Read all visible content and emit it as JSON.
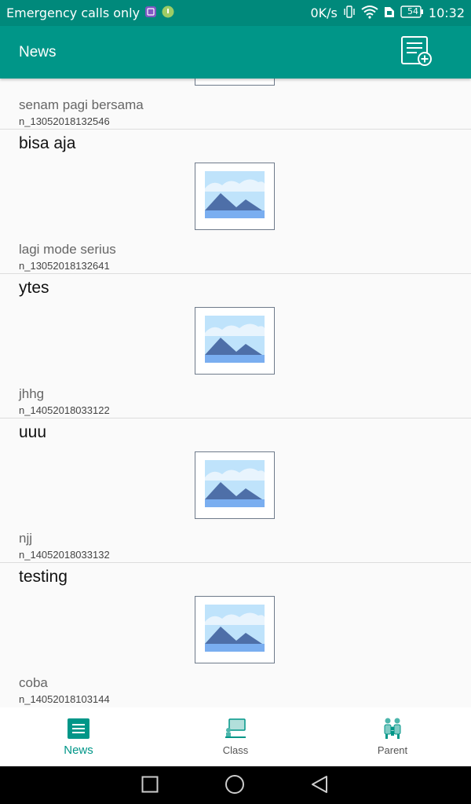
{
  "status_bar": {
    "carrier_text": "Emergency calls only",
    "net_speed": "0K/s",
    "battery": "54",
    "time": "10:32"
  },
  "app_bar": {
    "title": "News",
    "add_icon": "add-news-icon"
  },
  "news_partial": {
    "description": "senam pagi bersama",
    "id": "n_13052018132546"
  },
  "news": [
    {
      "title": "bisa aja",
      "description": "lagi mode serius",
      "id": "n_13052018132641"
    },
    {
      "title": "ytes",
      "description": "jhhg",
      "id": "n_14052018033122"
    },
    {
      "title": "uuu",
      "description": "njj",
      "id": "n_14052018033132"
    },
    {
      "title": "testing",
      "description": "coba",
      "id": "n_14052018103144"
    }
  ],
  "bottom_nav": {
    "items": [
      {
        "label": "News",
        "icon": "news-icon",
        "active": true
      },
      {
        "label": "Class",
        "icon": "class-icon",
        "active": false
      },
      {
        "label": "Parent",
        "icon": "parent-icon",
        "active": false
      }
    ]
  },
  "colors": {
    "primary": "#009688",
    "status_bar": "#00897b",
    "accent_text": "#009688"
  }
}
